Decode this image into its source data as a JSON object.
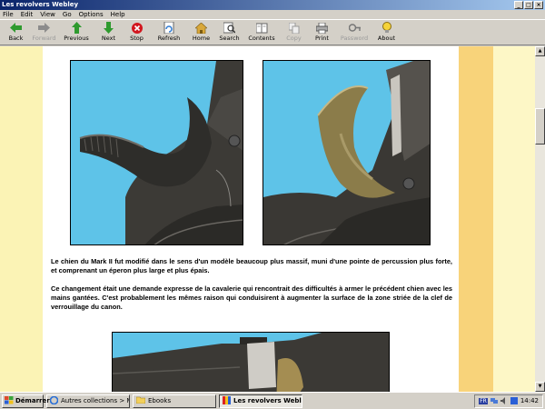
{
  "window": {
    "title": "Les revolvers Webley"
  },
  "menu": [
    "File",
    "Edit",
    "View",
    "Go",
    "Options",
    "Help"
  ],
  "toolbar": [
    {
      "label": "Back",
      "icon": "back-arrow-icon",
      "enabled": true
    },
    {
      "label": "Forward",
      "icon": "forward-arrow-icon",
      "enabled": false
    },
    {
      "label": "Previous",
      "icon": "up-arrow-icon",
      "enabled": true
    },
    {
      "label": "Next",
      "icon": "down-arrow-icon",
      "enabled": true
    },
    {
      "label": "Stop",
      "icon": "stop-icon",
      "enabled": true
    },
    {
      "label": "Refresh",
      "icon": "refresh-icon",
      "enabled": true
    },
    {
      "label": "Home",
      "icon": "home-icon",
      "enabled": true
    },
    {
      "label": "Search",
      "icon": "search-icon",
      "enabled": true
    },
    {
      "label": "Contents",
      "icon": "contents-icon",
      "enabled": true
    },
    {
      "label": "Copy",
      "icon": "copy-icon",
      "enabled": false
    },
    {
      "label": "Print",
      "icon": "print-icon",
      "enabled": true
    },
    {
      "label": "Password",
      "icon": "key-icon",
      "enabled": false
    },
    {
      "label": "About",
      "icon": "about-icon",
      "enabled": true
    }
  ],
  "content": {
    "paragraphs": [
      "Le chien du Mark II fut modifié dans le sens d'un modèle beaucoup plus massif, muni d'une pointe de percussion plus forte, et comprenant un éperon plus large et plus épais.",
      "Ce changement était une demande expresse de la cavalerie qui rencontrait des difficultés à armer le précédent chien avec les mains gantées. C'est probablement les mêmes raison qui conduisirent à augmenter la surface de la zone striée de la clef de verrouillage du canon."
    ]
  },
  "colors": {
    "left_margin": "#fbf3b5",
    "right_band": "#f8d37a",
    "photo_background": "#5ec3e8"
  },
  "taskbar": {
    "start": "Démarrer",
    "tasks": [
      {
        "label": "Autres collections > Milt...",
        "icon": "ie-icon",
        "active": false
      },
      {
        "label": "Ebooks",
        "icon": "folder-icon",
        "active": false
      },
      {
        "label": "Les revolvers Webley",
        "icon": "book-icon",
        "active": true
      }
    ],
    "tray": {
      "lang": "FR",
      "clock": "14:42"
    }
  }
}
